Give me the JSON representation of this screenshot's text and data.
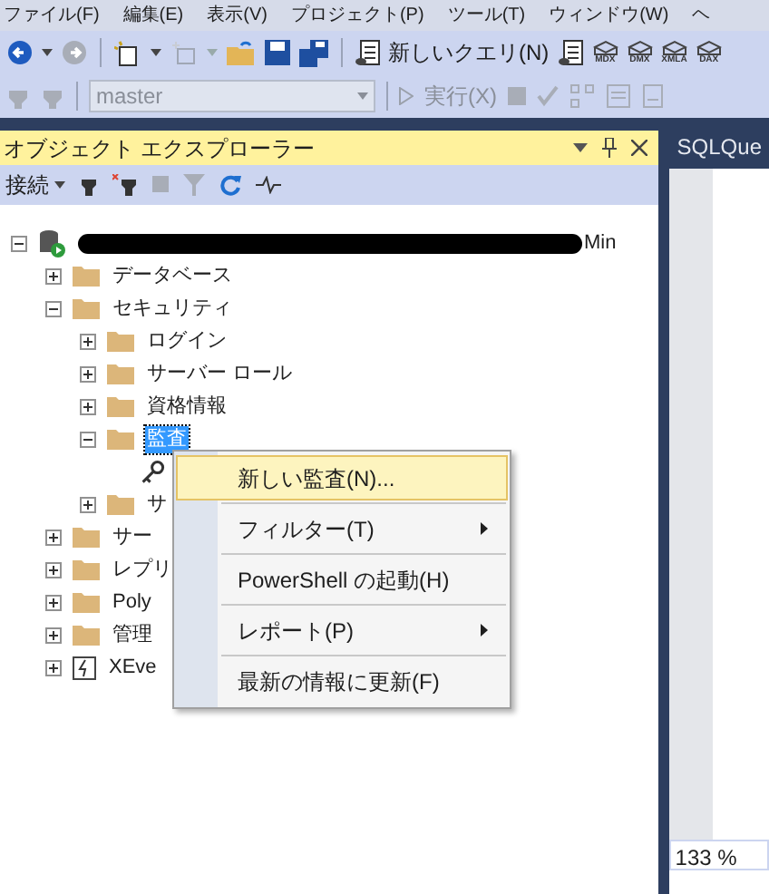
{
  "menu_bar": [
    "ファイル(F)",
    "編集(E)",
    "表示(V)",
    "プロジェクト(P)",
    "ツール(T)",
    "ウィンドウ(W)",
    "ヘ"
  ],
  "toolbar": {
    "new_query": "新しいクエリ(N)",
    "query_types": [
      "MDX",
      "DMX",
      "XMLA",
      "DAX"
    ]
  },
  "sql_toolbar": {
    "database": "master",
    "execute": "実行(X)"
  },
  "object_explorer": {
    "title": "オブジェクト エクスプローラー",
    "connect": "接続",
    "tree": [
      {
        "kind": "server",
        "label": "Min",
        "expanded": true,
        "selected": false,
        "children": [
          {
            "kind": "folder",
            "label": "データベース",
            "expanded": false,
            "selected": false
          },
          {
            "kind": "folder",
            "label": "セキュリティ",
            "expanded": true,
            "selected": false,
            "children": [
              {
                "kind": "folder",
                "label": "ログイン",
                "expanded": false,
                "selected": false
              },
              {
                "kind": "folder",
                "label": "サーバー ロール",
                "expanded": false,
                "selected": false
              },
              {
                "kind": "folder",
                "label": "資格情報",
                "expanded": false,
                "selected": false
              },
              {
                "kind": "folder",
                "label": "監査",
                "expanded": true,
                "selected": true,
                "children": [
                  {
                    "kind": "key"
                  }
                ]
              },
              {
                "kind": "folder",
                "label": "サ",
                "expanded": false,
                "selected": false
              }
            ]
          },
          {
            "kind": "folder",
            "label": "サー",
            "expanded": false,
            "selected": false
          },
          {
            "kind": "folder",
            "label": "レプリ",
            "expanded": false,
            "selected": false
          },
          {
            "kind": "folder",
            "label": "Poly",
            "expanded": false,
            "selected": false
          },
          {
            "kind": "folder",
            "label": "管理",
            "expanded": false,
            "selected": false
          },
          {
            "kind": "xevent",
            "label": "XEve",
            "expanded": false,
            "selected": false
          }
        ]
      }
    ]
  },
  "context_menu": [
    {
      "label": "新しい監査(N)...",
      "selected": true,
      "submenu": false
    },
    {
      "label": "フィルター(T)",
      "selected": false,
      "submenu": true
    },
    {
      "label": "PowerShell の起動(H)",
      "selected": false,
      "submenu": false
    },
    {
      "label": "レポート(P)",
      "selected": false,
      "submenu": true
    },
    {
      "label": "最新の情報に更新(F)",
      "selected": false,
      "submenu": false
    }
  ],
  "document": {
    "tab": "SQLQue",
    "zoom": "133 %"
  }
}
